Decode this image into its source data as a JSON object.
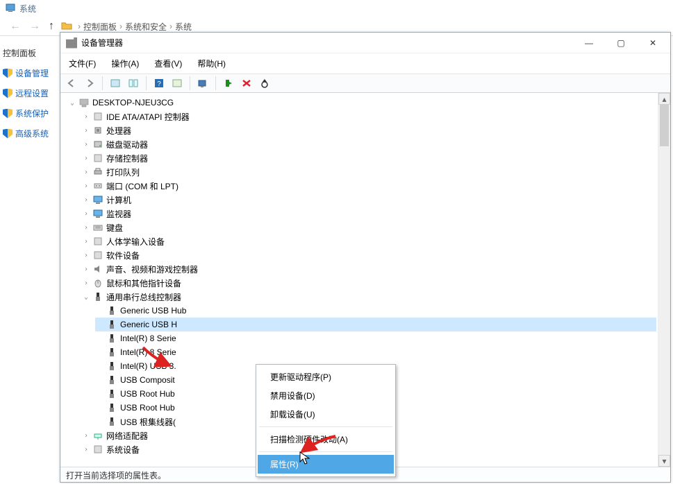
{
  "back": {
    "title": "系统",
    "crumbs": [
      "控制面板",
      "系统和安全",
      "系统"
    ]
  },
  "left_panel": {
    "items": [
      "控制面板",
      "设备管理",
      "远程设置",
      "系统保护",
      "高级系统"
    ]
  },
  "dm": {
    "title": "设备管理器",
    "menu": {
      "file": "文件(F)",
      "action": "操作(A)",
      "view": "查看(V)",
      "help": "帮助(H)"
    },
    "statusbar": "打开当前选择项的属性表。",
    "root": "DESKTOP-NJEU3CG",
    "categories": [
      {
        "name": "IDE ATA/ATAPI 控制器",
        "icon": "ide"
      },
      {
        "name": "处理器",
        "icon": "cpu"
      },
      {
        "name": "磁盘驱动器",
        "icon": "disk"
      },
      {
        "name": "存储控制器",
        "icon": "storage"
      },
      {
        "name": "打印队列",
        "icon": "printer"
      },
      {
        "name": "端口 (COM 和 LPT)",
        "icon": "port"
      },
      {
        "name": "计算机",
        "icon": "monitor"
      },
      {
        "name": "监视器",
        "icon": "monitor"
      },
      {
        "name": "键盘",
        "icon": "keyboard"
      },
      {
        "name": "人体学输入设备",
        "icon": "hid"
      },
      {
        "name": "软件设备",
        "icon": "soft"
      },
      {
        "name": "声音、视频和游戏控制器",
        "icon": "audio"
      },
      {
        "name": "鼠标和其他指针设备",
        "icon": "mouse"
      }
    ],
    "usb_category": "通用串行总线控制器",
    "usb_devices": [
      "Generic USB Hub",
      "Generic USB H",
      "Intel(R) 8 Serie",
      "Intel(R) 8 Serie",
      "Intel(R) USB 3.",
      "USB Composit",
      "USB Root Hub",
      "USB Root Hub",
      "USB 根集线器("
    ],
    "after": [
      "网络适配器",
      "系统设备"
    ],
    "context_menu": {
      "update": "更新驱动程序(P)",
      "disable": "禁用设备(D)",
      "uninstall": "卸载设备(U)",
      "scan": "扫描检测硬件改动(A)",
      "properties": "属性(R)"
    }
  }
}
